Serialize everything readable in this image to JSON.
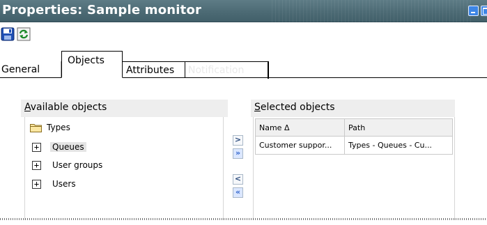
{
  "window": {
    "title": "Properties: Sample monitor"
  },
  "toolbar": {
    "save_icon": "save-icon",
    "refresh_icon": "refresh-icon"
  },
  "tabs": [
    {
      "label": "General"
    },
    {
      "label": "Objects",
      "selected": true
    },
    {
      "label": "Attributes"
    },
    {
      "label": "Notification",
      "disabled": true
    }
  ],
  "available": {
    "header_accel": "A",
    "header_rest": "vailable objects",
    "root": {
      "label": "Types"
    },
    "items": [
      {
        "label": "Queues",
        "selected": true
      },
      {
        "label": "User groups"
      },
      {
        "label": "Users"
      }
    ]
  },
  "selected": {
    "header_accel": "S",
    "header_rest": "elected objects",
    "columns": {
      "name": "Name Δ",
      "path": "Path"
    },
    "rows": [
      {
        "name": "Customer suppor...",
        "path": "Types - Queues - Cu..."
      }
    ]
  },
  "movers": {
    "add": ">",
    "add_all": "»",
    "remove": "<",
    "remove_all": "«"
  },
  "tree": {
    "expand_glyph": "+"
  },
  "colors": {
    "titlebar": "#4c6a74",
    "title_text": "#ffffff",
    "group_header_bg": "#eeeeee",
    "selection_bg": "#e4e4e4"
  }
}
